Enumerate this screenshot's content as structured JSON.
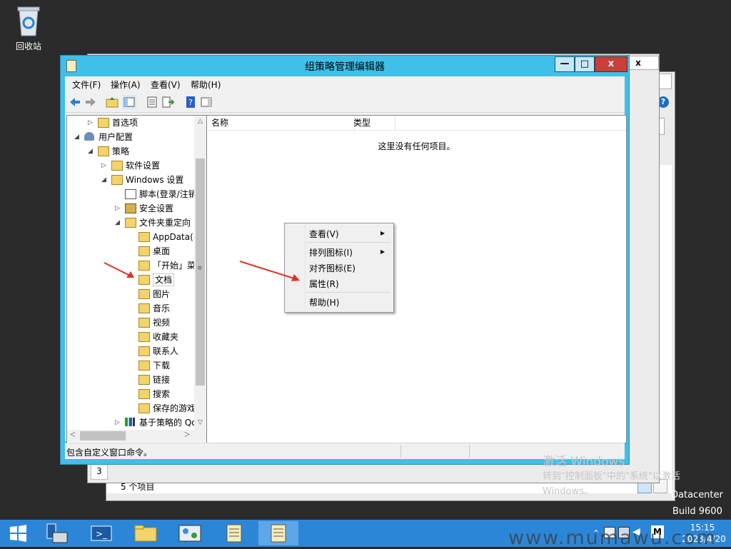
{
  "desktop": {
    "recycle_label": "回收站"
  },
  "main_window": {
    "title": "组策略管理编辑器",
    "controls": {
      "minimize": "—",
      "maximize": "□",
      "close": "x"
    },
    "menu": [
      "文件(F)",
      "操作(A)",
      "查看(V)",
      "帮助(H)"
    ],
    "tree": [
      {
        "label": "首选项",
        "arrow": "▷"
      },
      {
        "label": "用户配置",
        "arrow": "◢"
      },
      {
        "label": "策略",
        "arrow": "◢"
      },
      {
        "label": "软件设置",
        "arrow": "▷"
      },
      {
        "label": "Windows 设置",
        "arrow": "◢"
      },
      {
        "label": "脚本(登录/注销)",
        "arrow": ""
      },
      {
        "label": "安全设置",
        "arrow": "▷"
      },
      {
        "label": "文件夹重定向",
        "arrow": "◢"
      },
      {
        "label": "AppData(Roaming)",
        "arrow": ""
      },
      {
        "label": "桌面",
        "arrow": ""
      },
      {
        "label": "「开始」菜单",
        "arrow": ""
      },
      {
        "label": "文档",
        "arrow": ""
      },
      {
        "label": "图片",
        "arrow": ""
      },
      {
        "label": "音乐",
        "arrow": ""
      },
      {
        "label": "视频",
        "arrow": ""
      },
      {
        "label": "收藏夹",
        "arrow": ""
      },
      {
        "label": "联系人",
        "arrow": ""
      },
      {
        "label": "下载",
        "arrow": ""
      },
      {
        "label": "链接",
        "arrow": ""
      },
      {
        "label": "搜索",
        "arrow": ""
      },
      {
        "label": "保存的游戏",
        "arrow": ""
      },
      {
        "label": "基于策略的 QoS",
        "arrow": "▷"
      }
    ],
    "list": {
      "columns": [
        "名称",
        "类型"
      ],
      "empty_text": "这里没有任何项目。"
    },
    "status_text": "包含自定义窗口命令。"
  },
  "context_menu": {
    "items": [
      "查看(V)",
      "排列图标(I)",
      "对齐图标(E)",
      "属性(R)",
      "帮助(H)"
    ],
    "submenu_arrow": "▸"
  },
  "background_window": {
    "controls": {
      "close": "x"
    },
    "status_text": "5 个项目",
    "tail_char": "3"
  },
  "activation": {
    "title": "激活 Windows",
    "line1": "转到\"控制面板\"中的\"系统\"以激活",
    "line2": "Windows。"
  },
  "system_info": {
    "edition": "Datacenter",
    "build": "Build 9600"
  },
  "clock": {
    "time": "15:15",
    "date": "2023/4/20"
  },
  "tray_letter": "M",
  "overlay_watermark": "www.mumawu.com",
  "colors": {
    "title_bar": "#3fbfe9",
    "taskbar": "#2c86d8",
    "annotation_arrow": "#e0322c",
    "folder": "#f3d36b"
  }
}
